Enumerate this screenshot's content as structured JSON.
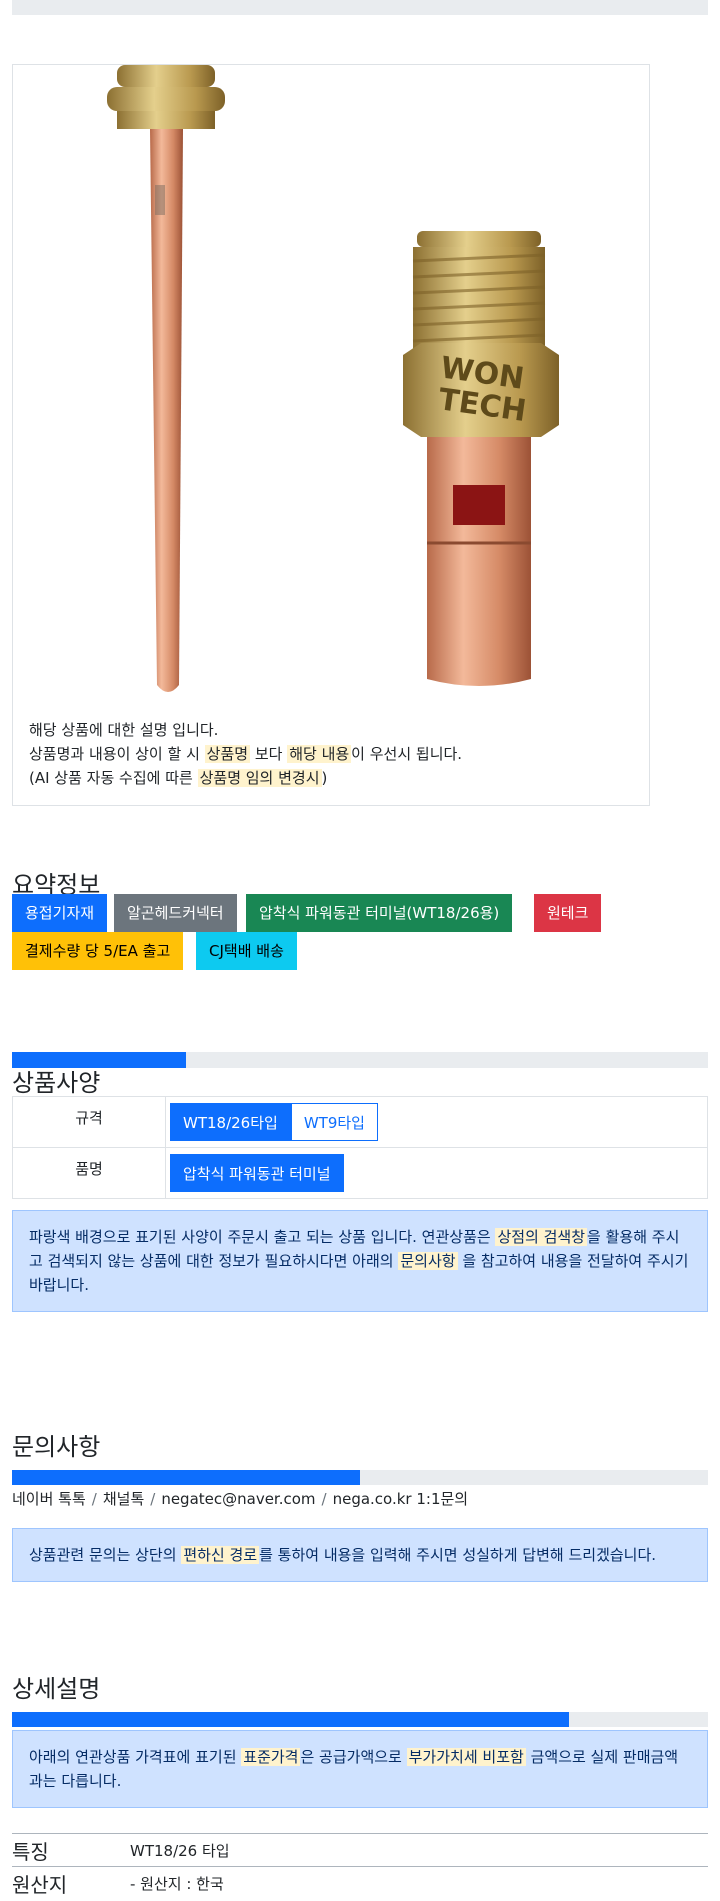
{
  "product": {
    "description": {
      "line1": "해당 상품에 대한 설명 입니다.",
      "line2_a": "상품명과 내용이 상이 할 시 ",
      "line2_hl1": "상품명",
      "line2_b": " 보다 ",
      "line2_hl2": "해당 내용",
      "line2_c": "이 우선시 됩니다.",
      "line3_a": "(AI 상품 자동 수집에 따른 ",
      "line3_hl": "상품명 임의 변경시",
      "line3_b": ")"
    },
    "image_labels": [
      "WON",
      "TECH"
    ]
  },
  "summary": {
    "title": "요약정보",
    "badges": [
      {
        "label": "용접기자재",
        "color": "#0d6efd"
      },
      {
        "label": "알곤헤드커넥터",
        "color": "#6c757d"
      },
      {
        "label": "압착식 파워동관 터미널(WT18/26용)",
        "color": "#198754"
      },
      {
        "label": "원테크",
        "color": "#dc3545"
      },
      {
        "label": "결제수량 당 5/EA 출고",
        "color": "#ffc107"
      },
      {
        "label": "CJ택배 배송",
        "color": "#0dcaf0"
      }
    ]
  },
  "spec": {
    "progress": 0.25,
    "title": "상품사양",
    "rows": [
      {
        "key": "규격",
        "options": [
          {
            "label": "WT18/26타입",
            "selected": true
          },
          {
            "label": "WT9타입",
            "selected": false
          }
        ]
      },
      {
        "key": "품명",
        "options": [
          {
            "label": "압착식 파워동관 터미널",
            "selected": true
          }
        ]
      }
    ],
    "notice": {
      "a": "파랑색 배경으로 표기된 사양이 주문시 출고 되는 상품 입니다. 연관상품은 ",
      "hl1": "상점의 검색창",
      "b": "을 활용해 주시고 검색되지 않는 상품에 대한 정보가 필요하시다면 아래의 ",
      "hl2": "문의사항",
      "c": " 을 참고하여 내용을 전달하여 주시기 바랍니다."
    }
  },
  "inquiry": {
    "title": "문의사항",
    "progress": 0.5,
    "channels": [
      "네이버 톡톡",
      "채널톡",
      "negatec@naver.com",
      "nega.co.kr 1:1문의"
    ],
    "notice": {
      "a": "상품관련 문의는 상단의 ",
      "hl": "편하신 경로",
      "b": "를 통하여 내용을 입력해 주시면 성실하게 답변해 드리겠습니다."
    }
  },
  "detail": {
    "title": "상세설명",
    "progress": 0.8,
    "notice": {
      "a": "아래의 연관상품 가격표에 표기된 ",
      "hl1": "표준가격",
      "b": "은 공급가액으로 ",
      "hl2": "부가가치세 비포함",
      "c": " 금액으로 실제 판매금액과는 다릅니다."
    },
    "features": [
      {
        "key": "특징",
        "value": "WT18/26 타입"
      },
      {
        "key": "원산지",
        "value": "- 원산지 : 한국"
      }
    ]
  }
}
